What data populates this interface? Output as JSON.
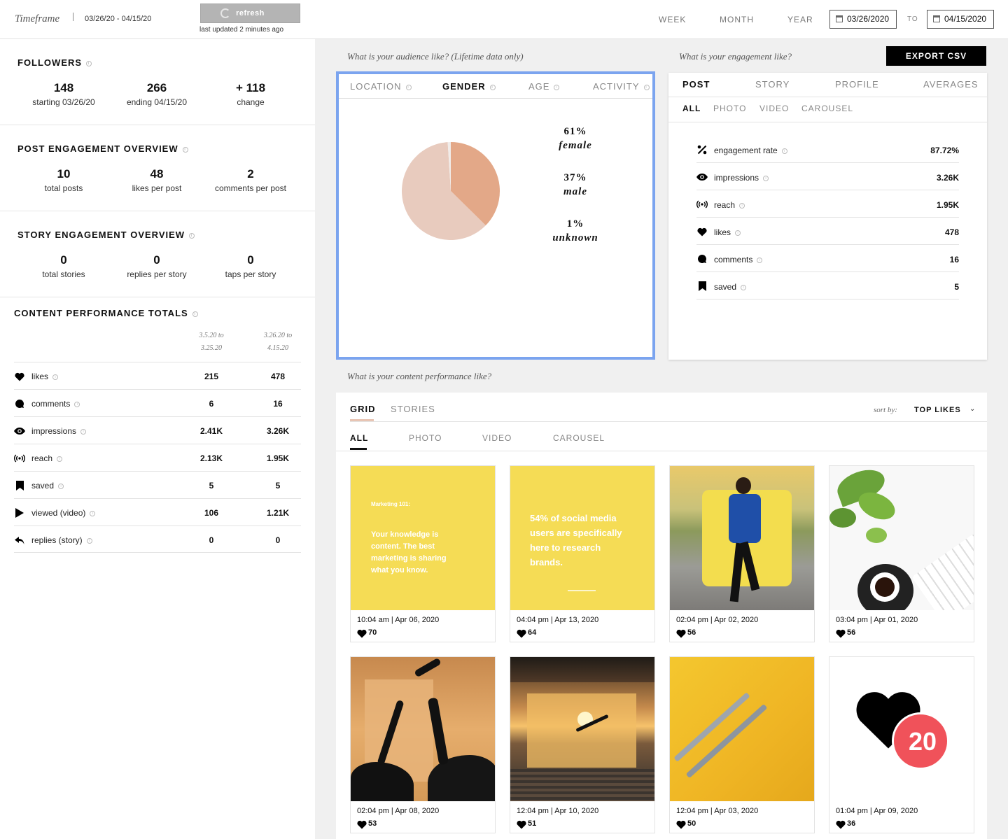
{
  "header": {
    "timeframe_label": "Timeframe",
    "range": "03/26/20 - 04/15/20",
    "refresh_label": "refresh",
    "last_updated": "last updated 2 minutes ago",
    "periods": [
      "WEEK",
      "MONTH",
      "YEAR"
    ],
    "start_date": "03/26/2020",
    "to_label": "TO",
    "end_date": "04/15/2020"
  },
  "followers": {
    "title": "FOLLOWERS",
    "stats": [
      {
        "num": "148",
        "label": "starting 03/26/20"
      },
      {
        "num": "266",
        "label": "ending 04/15/20"
      },
      {
        "num": "+ 118",
        "label": "change"
      }
    ]
  },
  "post_engagement": {
    "title": "POST ENGAGEMENT OVERVIEW",
    "stats": [
      {
        "num": "10",
        "label": "total posts"
      },
      {
        "num": "48",
        "label": "likes per post"
      },
      {
        "num": "2",
        "label": "comments per post"
      }
    ]
  },
  "story_engagement": {
    "title": "STORY ENGAGEMENT OVERVIEW",
    "stats": [
      {
        "num": "0",
        "label": "total stories"
      },
      {
        "num": "0",
        "label": "replies per story"
      },
      {
        "num": "0",
        "label": "taps per story"
      }
    ]
  },
  "content_totals": {
    "title": "CONTENT PERFORMANCE TOTALS",
    "col1": [
      "3.5.20 to",
      "3.25.20"
    ],
    "col2": [
      "3.26.20 to",
      "4.15.20"
    ],
    "rows": [
      {
        "icon": "heart-icon",
        "label": "likes",
        "v1": "215",
        "v2": "478"
      },
      {
        "icon": "comment-icon",
        "label": "comments",
        "v1": "6",
        "v2": "16"
      },
      {
        "icon": "eye-icon",
        "label": "impressions",
        "v1": "2.41K",
        "v2": "3.26K"
      },
      {
        "icon": "broadcast-icon",
        "label": "reach",
        "v1": "2.13K",
        "v2": "1.95K"
      },
      {
        "icon": "bookmark-icon",
        "label": "saved",
        "v1": "5",
        "v2": "5"
      },
      {
        "icon": "play-icon",
        "label": "viewed (video)",
        "v1": "106",
        "v2": "1.21K"
      },
      {
        "icon": "reply-icon",
        "label": "replies (story)",
        "v1": "0",
        "v2": "0"
      }
    ]
  },
  "audience": {
    "caption": "What is your audience like? (Lifetime data only)",
    "tabs": [
      "LOCATION",
      "GENDER",
      "AGE",
      "ACTIVITY"
    ],
    "active_tab": "GENDER",
    "chart_data": {
      "type": "pie",
      "slices": [
        {
          "label": "female",
          "value": 61,
          "display": "61%",
          "color": "#e8cbbe"
        },
        {
          "label": "male",
          "value": 37,
          "display": "37%",
          "color": "#e3a888"
        },
        {
          "label": "unknown",
          "value": 1,
          "display": "1%",
          "color": "#f1ece9"
        }
      ]
    }
  },
  "engagement": {
    "caption": "What is your engagement like?",
    "export_label": "EXPORT CSV",
    "tabs": [
      "POST",
      "STORY",
      "PROFILE",
      "AVERAGES"
    ],
    "subtabs": [
      "ALL",
      "PHOTO",
      "VIDEO",
      "CAROUSEL"
    ],
    "rows": [
      {
        "icon": "percent-icon",
        "label": "engagement rate",
        "value": "87.72%"
      },
      {
        "icon": "eye-icon",
        "label": "impressions",
        "value": "3.26K"
      },
      {
        "icon": "broadcast-icon",
        "label": "reach",
        "value": "1.95K"
      },
      {
        "icon": "heart-icon",
        "label": "likes",
        "value": "478"
      },
      {
        "icon": "comment-icon",
        "label": "comments",
        "value": "16"
      },
      {
        "icon": "bookmark-icon",
        "label": "saved",
        "value": "5"
      }
    ]
  },
  "content": {
    "caption": "What is your content performance like?",
    "tabs": [
      "GRID",
      "STORIES"
    ],
    "sort_label": "sort by:",
    "sort_value": "TOP LIKES",
    "subtabs": [
      "ALL",
      "PHOTO",
      "VIDEO",
      "CAROUSEL"
    ],
    "posts": [
      {
        "time": "10:04 am | Apr 06, 2020",
        "likes": "70",
        "title": "Marketing 101:",
        "text": "Your knowledge is content. The best marketing is sharing what you know."
      },
      {
        "time": "04:04 pm | Apr 13, 2020",
        "likes": "64",
        "text": "54% of social media users are specifically here to research brands."
      },
      {
        "time": "02:04 pm | Apr 02, 2020",
        "likes": "56"
      },
      {
        "time": "03:04 pm | Apr 01, 2020",
        "likes": "56"
      },
      {
        "time": "02:04 pm | Apr 08, 2020",
        "likes": "53"
      },
      {
        "time": "12:04 pm | Apr 10, 2020",
        "likes": "51"
      },
      {
        "time": "12:04 pm | Apr 03, 2020",
        "likes": "50"
      },
      {
        "time": "01:04 pm | Apr 09, 2020",
        "likes": "36",
        "badge": "20"
      }
    ]
  }
}
